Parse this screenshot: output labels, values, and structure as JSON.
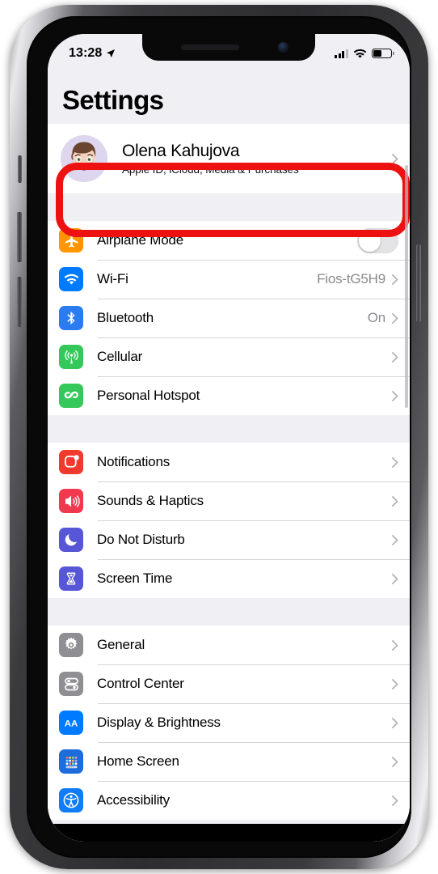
{
  "status_bar": {
    "time": "13:28",
    "location_icon": "location-arrow-icon",
    "signal_icon": "cellular-signal-icon",
    "signal_bars": 4,
    "wifi_icon": "wifi-icon",
    "battery_icon": "battery-icon",
    "battery_level_pct": 48
  },
  "header": {
    "title": "Settings"
  },
  "profile": {
    "name": "Olena Kahujova",
    "subtitle": "Apple ID, iCloud, Media & Purchases",
    "avatar_name": "memoji-avatar",
    "avatar_bg": "#ded5ef",
    "chevron": "chevron-right-icon",
    "highlighted": true
  },
  "annotation": {
    "type": "rounded-rectangle-highlight",
    "color": "#ee1111",
    "target": "profile-row"
  },
  "groups": [
    {
      "name": "connectivity",
      "rows": [
        {
          "label": "Airplane Mode",
          "icon": "airplane-icon",
          "icon_bg": "#ff9500",
          "accessory": "toggle",
          "toggle_on": false,
          "value": ""
        },
        {
          "label": "Wi-Fi",
          "icon": "wifi-icon",
          "icon_bg": "#007aff",
          "accessory": "chevron",
          "value": "Fios-tG5H9"
        },
        {
          "label": "Bluetooth",
          "icon": "bluetooth-icon",
          "icon_bg": "#2b7cf0",
          "accessory": "chevron",
          "value": "On"
        },
        {
          "label": "Cellular",
          "icon": "cellular-antenna-icon",
          "icon_bg": "#34c759",
          "accessory": "chevron",
          "value": ""
        },
        {
          "label": "Personal Hotspot",
          "icon": "hotspot-link-icon",
          "icon_bg": "#34c759",
          "accessory": "chevron",
          "value": ""
        }
      ]
    },
    {
      "name": "alerts",
      "rows": [
        {
          "label": "Notifications",
          "icon": "notifications-badge-icon",
          "icon_bg": "#f03a2e",
          "accessory": "chevron",
          "value": ""
        },
        {
          "label": "Sounds & Haptics",
          "icon": "speaker-waves-icon",
          "icon_bg": "#f2384f",
          "accessory": "chevron",
          "value": ""
        },
        {
          "label": "Do Not Disturb",
          "icon": "crescent-moon-icon",
          "icon_bg": "#5756d6",
          "accessory": "chevron",
          "value": ""
        },
        {
          "label": "Screen Time",
          "icon": "hourglass-icon",
          "icon_bg": "#5756d6",
          "accessory": "chevron",
          "value": ""
        }
      ]
    },
    {
      "name": "system",
      "rows": [
        {
          "label": "General",
          "icon": "gear-icon",
          "icon_bg": "#8e8e93",
          "accessory": "chevron",
          "value": ""
        },
        {
          "label": "Control Center",
          "icon": "control-toggles-icon",
          "icon_bg": "#8e8e93",
          "accessory": "chevron",
          "value": ""
        },
        {
          "label": "Display & Brightness",
          "icon": "display-aa-icon",
          "icon_bg": "#007aff",
          "accessory": "chevron",
          "value": ""
        },
        {
          "label": "Home Screen",
          "icon": "home-screen-grid-icon",
          "icon_bg": "#1c6ddb",
          "accessory": "chevron",
          "value": ""
        },
        {
          "label": "Accessibility",
          "icon": "accessibility-person-icon",
          "icon_bg": "#107cf5",
          "accessory": "chevron",
          "value": ""
        }
      ]
    }
  ]
}
